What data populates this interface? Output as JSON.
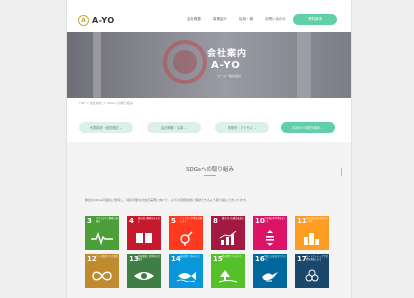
{
  "header": {
    "logo_text": "A-YO",
    "nav": [
      "会社概要",
      "事業紹介",
      "採用・働",
      "お問い合わせ"
    ],
    "contact_label": "資料請求"
  },
  "hero": {
    "title": "会社案内",
    "subtitle": "A-YO",
    "caption": "エーヨー株式会社"
  },
  "breadcrumb": "TOP ＞ 会社案内 ＞ SDGsへの取り組み",
  "pills": [
    {
      "label": "代表挨拶・経営理念",
      "active": false
    },
    {
      "label": "会社概要・沿革",
      "active": false
    },
    {
      "label": "事業所・アクセス",
      "active": false
    },
    {
      "label": "SDGsへの取り組み",
      "active": true
    }
  ],
  "sdg": {
    "heading": "SDGsへの取り組み",
    "description": "弊社はSDGsの理念に賛同し、持続可能な社会の実現に向けて、以下の目標達成に貢献できるよう取り組んでまいります。",
    "tiles": [
      {
        "num": "3",
        "label": "すべての人に健康と福祉を",
        "color": "#4c9f38",
        "icon": "heartbeat-icon"
      },
      {
        "num": "4",
        "label": "質の高い教育をみんなに",
        "color": "#c5192d",
        "icon": "book-icon"
      },
      {
        "num": "5",
        "label": "ジェンダー平等を実現しよう",
        "color": "#ff3a21",
        "icon": "gender-icon"
      },
      {
        "num": "8",
        "label": "働きがいも経済成長も",
        "color": "#a21942",
        "icon": "growth-chart-icon"
      },
      {
        "num": "10",
        "label": "人や国の不平等をなくそう",
        "color": "#dd1367",
        "icon": "equality-icon"
      },
      {
        "num": "11",
        "label": "住み続けられるまちづくりを",
        "color": "#fd9d24",
        "icon": "city-icon"
      },
      {
        "num": "12",
        "label": "つくる責任つかう責任",
        "color": "#bf8b2e",
        "icon": "infinity-icon"
      },
      {
        "num": "13",
        "label": "気候変動に具体的な対策を",
        "color": "#3f7e44",
        "icon": "eye-globe-icon"
      },
      {
        "num": "14",
        "label": "海の豊かさを守ろう",
        "color": "#0a97d9",
        "icon": "fish-icon"
      },
      {
        "num": "15",
        "label": "陸の豊かさも守ろう",
        "color": "#56c02b",
        "icon": "tree-icon"
      },
      {
        "num": "16",
        "label": "平和と公正をすべての人に",
        "color": "#00689d",
        "icon": "dove-icon"
      },
      {
        "num": "17",
        "label": "パートナーシップで目標を達成しよう",
        "color": "#19486a",
        "icon": "partnership-icon"
      }
    ]
  }
}
